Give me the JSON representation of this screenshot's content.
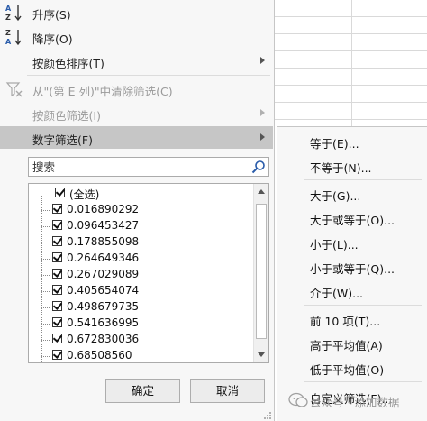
{
  "menu": {
    "sort_asc": "升序(S)",
    "sort_desc": "降序(O)",
    "sort_by_color": "按颜色排序(T)",
    "clear_filter": "从\"(第 E 列)\"中清除筛选(C)",
    "filter_by_color": "按颜色筛选(I)",
    "number_filters": "数字筛选(F)"
  },
  "search": {
    "placeholder": "搜索"
  },
  "list": {
    "select_all": "(全选)",
    "values": [
      "0.016890292",
      "0.096453427",
      "0.178855098",
      "0.264649346",
      "0.267029089",
      "0.405654074",
      "0.498679735",
      "0.541636995",
      "0.672830036",
      "0.68508560"
    ]
  },
  "buttons": {
    "ok": "确定",
    "cancel": "取消"
  },
  "submenu": {
    "items": [
      "等于(E)...",
      "不等于(N)...",
      "大于(G)...",
      "大于或等于(O)...",
      "小于(L)...",
      "小于或等于(Q)...",
      "介于(W)...",
      "前 10 项(T)...",
      "高于平均值(A)",
      "低于平均值(O)",
      "自定义筛选(F)..."
    ]
  },
  "watermark": {
    "text": "公众号 · 添加数据"
  },
  "colors": {
    "menu_bg": "#f7f7f7",
    "highlight": "#c6c6c6",
    "disabled_text": "#9a9a9a"
  }
}
